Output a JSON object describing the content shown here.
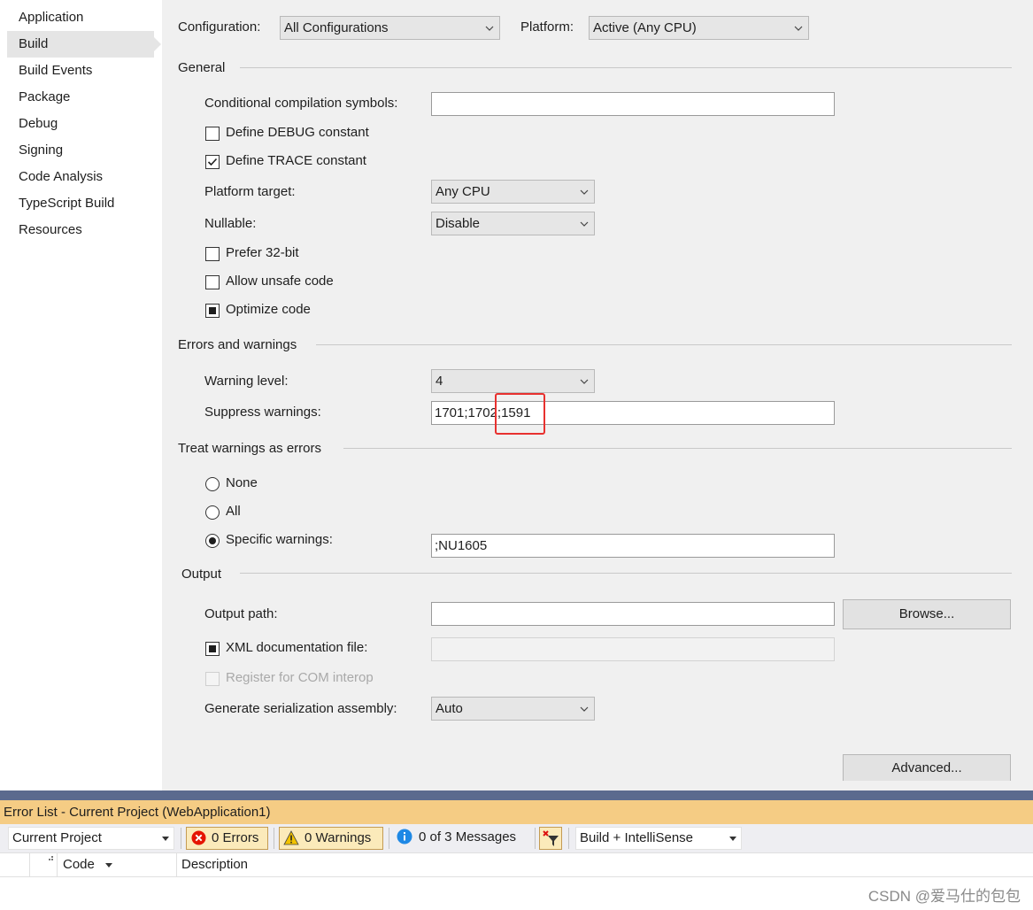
{
  "sidebar": {
    "items": [
      {
        "label": "Application"
      },
      {
        "label": "Build"
      },
      {
        "label": "Build Events"
      },
      {
        "label": "Package"
      },
      {
        "label": "Debug"
      },
      {
        "label": "Signing"
      },
      {
        "label": "Code Analysis"
      },
      {
        "label": "TypeScript Build"
      },
      {
        "label": "Resources"
      }
    ],
    "active": "Build"
  },
  "header": {
    "configuration_label": "Configuration:",
    "configuration_value": "All Configurations",
    "platform_label": "Platform:",
    "platform_value": "Active (Any CPU)"
  },
  "general": {
    "title": "General",
    "conditional_label": "Conditional compilation symbols:",
    "conditional_value": "",
    "define_debug_label": "Define DEBUG constant",
    "define_debug_checked": false,
    "define_trace_label": "Define TRACE constant",
    "define_trace_checked": true,
    "platform_target_label": "Platform target:",
    "platform_target_value": "Any CPU",
    "nullable_label": "Nullable:",
    "nullable_value": "Disable",
    "prefer32_label": "Prefer 32-bit",
    "prefer32_checked": false,
    "unsafe_label": "Allow unsafe code",
    "unsafe_checked": false,
    "optimize_label": "Optimize code",
    "optimize_state": "indeterminate"
  },
  "errors_warnings": {
    "title": "Errors and warnings",
    "warning_level_label": "Warning level:",
    "warning_level_value": "4",
    "suppress_label": "Suppress warnings:",
    "suppress_value": "1701;1702;1591"
  },
  "treat_warnings": {
    "title": "Treat warnings as errors",
    "none_label": "None",
    "all_label": "All",
    "specific_label": "Specific warnings:",
    "selected": "specific",
    "specific_value": ";NU1605"
  },
  "output": {
    "title": "Output",
    "output_path_label": "Output path:",
    "output_path_value": "",
    "browse_label": "Browse...",
    "xml_doc_label": "XML documentation file:",
    "xml_doc_state": "indeterminate",
    "xml_doc_value": "",
    "com_interop_label": "Register for COM interop",
    "com_interop_enabled": false,
    "serialization_label": "Generate serialization assembly:",
    "serialization_value": "Auto",
    "advanced_label": "Advanced..."
  },
  "error_list": {
    "title": "Error List - Current Project (WebApplication1)",
    "scope_value": "Current Project",
    "errors_label": "0 Errors",
    "warnings_label": "0 Warnings",
    "messages_label": "0 of 3 Messages",
    "source_value": "Build + IntelliSense",
    "columns": [
      "Code",
      "Description"
    ]
  },
  "watermark": "CSDN @爱马仕的包包",
  "colors": {
    "panel_bg": "#f0f0f0",
    "sidebar_active": "#e5e5e5",
    "error_title_bg": "#f5cc84",
    "divider": "#5b6a8e",
    "highlight": "#e8312f",
    "error_icon": "#e51400",
    "warning_icon": "#f2c200",
    "info_icon": "#1e88e5"
  }
}
